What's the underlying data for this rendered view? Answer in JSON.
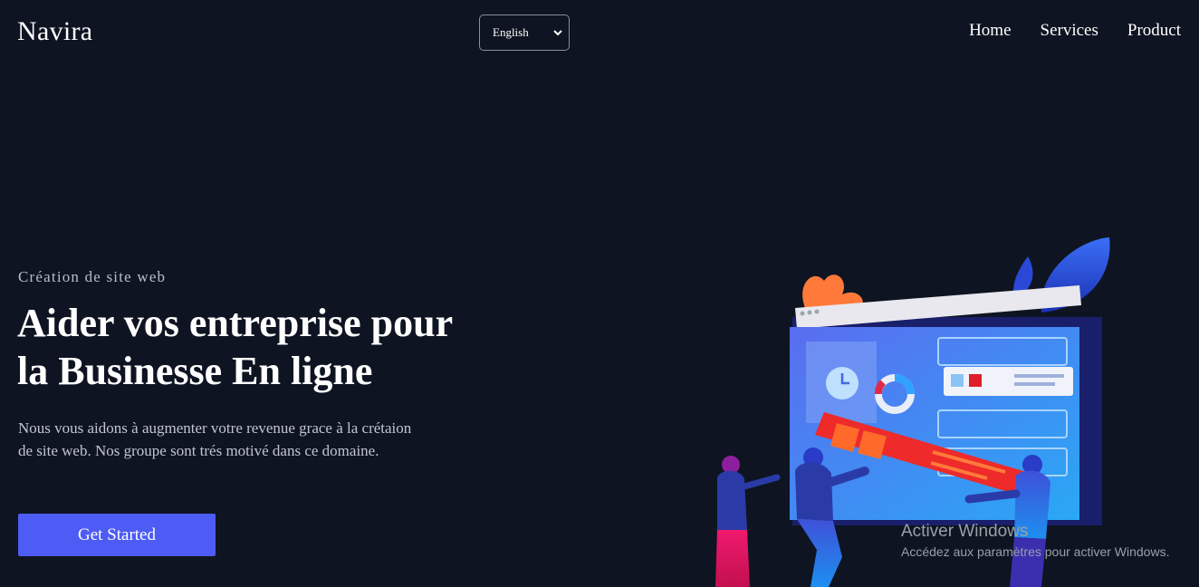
{
  "header": {
    "brand": "Navira",
    "language_select": {
      "selected": "English"
    },
    "nav": [
      "Home",
      "Services",
      "Product"
    ]
  },
  "hero": {
    "eyebrow": "Création de site web",
    "headline_line1": "Aider vos entreprise pour",
    "headline_line2": "la Businesse En ligne",
    "description": "Nous vous aidons à augmenter votre revenue grace à la crétaion de site web. Nos groupe sont trés motivé dans ce domaine.",
    "cta_label": "Get Started"
  },
  "watermark": {
    "title": "Activer Windows",
    "subtitle": "Accédez aux paramètres pour activer Windows."
  },
  "colors": {
    "background": "#0e1421",
    "accent": "#4d5cf5",
    "text": "#ffffff",
    "muted_text": "#c1c6d0"
  },
  "icons": {
    "language_chevron": "chevron-down-icon",
    "hero_art": "website-building-illustration"
  }
}
